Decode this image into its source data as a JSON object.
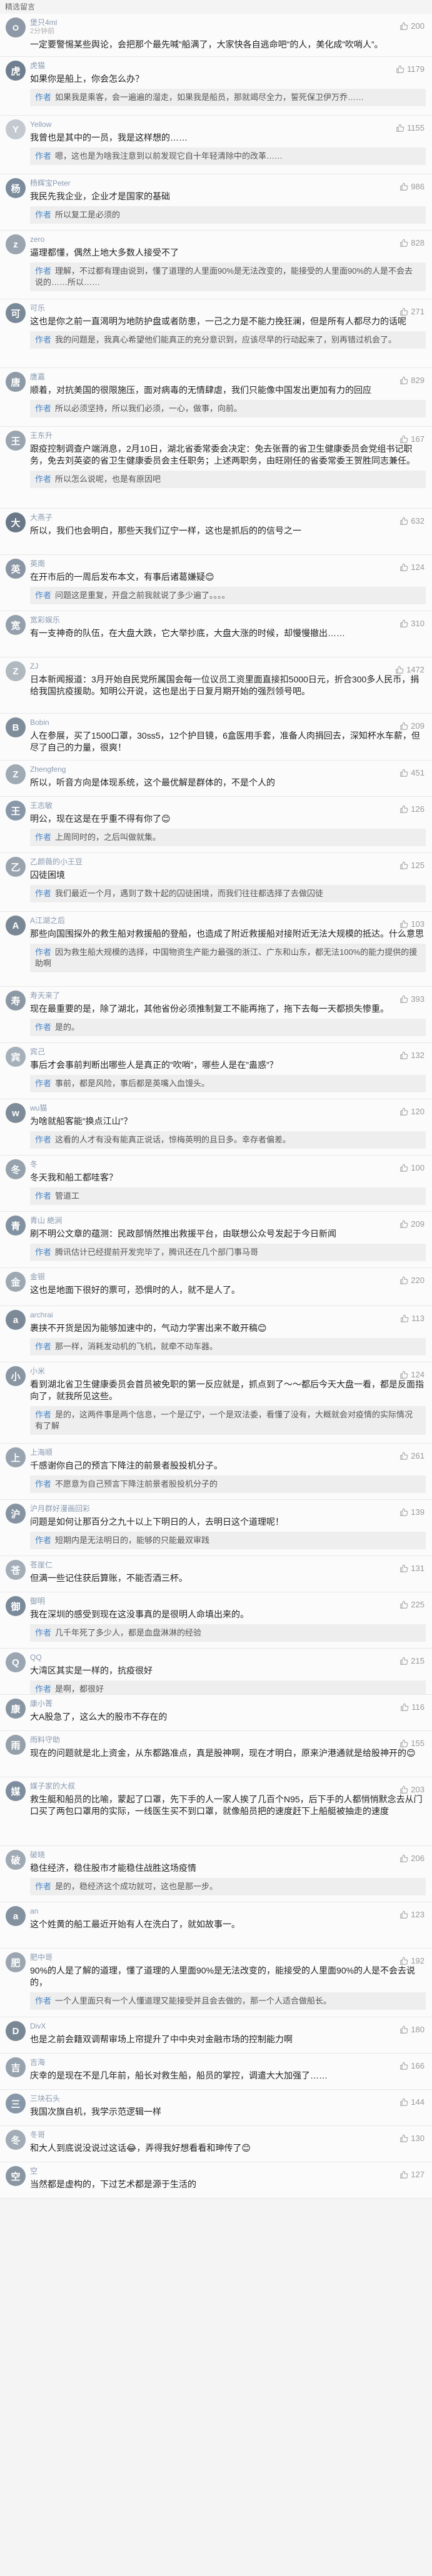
{
  "header": {
    "title": "精选留言"
  },
  "comments": [
    {
      "avatar": "ㅇ",
      "avatar_color": "#8d99a6",
      "user": "堡只4ml",
      "time": "2分钟前",
      "likes": "200",
      "text": "一定要警惕某些舆论，会把那个最先喊”船满了，大家快各自逃命吧”的人，美化成”吹哨人”。",
      "reply_author": "",
      "reply": "",
      "h": 69
    },
    {
      "avatar": "虎",
      "avatar_color": "#6f7f8f",
      "user": "虎猫",
      "time": "",
      "likes": "1179",
      "text": "如果你是船上，你会怎么办？",
      "reply_author": "作者",
      "reply": "如果我是乘客，会一遍遍的溜走，如果我是船员，那就竭尽全力，誓死保卫伊万乔……",
      "h": 94
    },
    {
      "avatar": "Y",
      "avatar_color": "#c3c9cf",
      "user": "Yellow",
      "time": "",
      "likes": "1155",
      "text": "我曾也是其中的一员，我是这样想的……",
      "reply_author": "作者",
      "reply": "嗯，这也是为啥我注意到以前发现它自十年轻清除中的改革……",
      "h": 94
    },
    {
      "avatar": "杨",
      "avatar_color": "#7c8c9c",
      "user": "杨辉宝Peter",
      "time": "",
      "likes": "986",
      "text": "我民先我企业，企业才是国家的基础",
      "reply_author": "作者",
      "reply": "所以复工是必须的",
      "h": 90
    },
    {
      "avatar": "z",
      "avatar_color": "#9aa5b0",
      "user": "zero",
      "time": "",
      "likes": "828",
      "text": "逼理都懂，偶然上地大多数人接受不了",
      "reply_author": "作者",
      "reply": "理解，不过都有理由说到，懂了道理的人里面90%是无法改变的，能接受的人里面90%的人是不会去说的……所以……",
      "h": 110
    },
    {
      "avatar": "可",
      "avatar_color": "#7a8a98",
      "user": "可乐",
      "time": "",
      "likes": "271",
      "text": "这也是你之前一直渴明为地防护盘或者防患，一己之力是不能力挽狂澜，但是所有人都尽力的话呢",
      "reply_author": "作者",
      "reply": "我的问题是，我真心希望他们能真正的充分意识到，应该尽早的行动起来了，别再错过机会了。",
      "h": 110
    },
    {
      "avatar": "唐",
      "avatar_color": "#8e9aa6",
      "user": "唐嘉",
      "time": "",
      "likes": "829",
      "text": "顺着，对抗美国的很限施压，面对病毒的无情肆虐，我们只能像中国发出更加有力的回应",
      "reply_author": "作者",
      "reply": "所以必须坚持，所以我们必须，一心，做事，向前。",
      "h": 94
    },
    {
      "avatar": "王",
      "avatar_color": "#9aa5b0",
      "user": "王东升",
      "time": "",
      "likes": "167",
      "text": "跟疫控制调查户端消息，2月10日，湖北省委常委会决定：免去张晋的省卫生健康委员会党组书记职务，免去刘英姿的省卫生健康委员会主任职务；上述两职务，由旺刚任的省委常委王贺胜同志兼任。",
      "reply_author": "作者",
      "reply": "所以怎么说呢，也是有原因吧",
      "h": 131
    },
    {
      "avatar": "大",
      "avatar_color": "#6a7888",
      "user": "大燕子",
      "time": "",
      "likes": "632",
      "text": "所以，我们也会明白，那些天我们辽宁一样，这也是抓后的的信号之一",
      "reply_author": "",
      "reply": "",
      "h": 74
    },
    {
      "avatar": "英",
      "avatar_color": "#8a96a4",
      "user": "英南",
      "time": "",
      "likes": "124",
      "text": "在开市后的一周后发布本文，有事后诸葛嫌疑😊",
      "reply_author": "作者",
      "reply": "问题这是重复，开盘之前我就说了多少遍了。。。。",
      "h": 90
    },
    {
      "avatar": "宽",
      "avatar_color": "#94a0ac",
      "user": "宽彩娱乐",
      "time": "",
      "likes": "310",
      "text": "有一支神奇的队伍，在大盘大跌，它大举抄底，大盘大涨的时候，却慢慢撤出……",
      "reply_author": "",
      "reply": "",
      "h": 74
    },
    {
      "avatar": "Z",
      "avatar_color": "#b0b8c0",
      "user": "ZJ",
      "time": "",
      "likes": "1472",
      "text": "日本新闻报道：3月开始自民党所属国会每一位议员工资里面直接扣5000日元，折合300多人民币，捐给我国抗疫援助。知明公开说，这也是出于日复月期开始的强烈领号吧。",
      "reply_author": "",
      "reply": "",
      "h": 90
    },
    {
      "avatar": "B",
      "avatar_color": "#7f8d9b",
      "user": "Bobin",
      "time": "",
      "likes": "209",
      "text": "人在参展，买了1500口罩，30ss5，12个护目镜，6盒医用手套，准备人肉捐回去，深知杯水车薪，但尽了自己的力量，很爽！",
      "reply_author": "",
      "reply": "",
      "h": 75
    },
    {
      "avatar": "Z",
      "avatar_color": "#a0aab4",
      "user": "Zhengfeng",
      "time": "",
      "likes": "451",
      "text": "所以，听音方向是体现系统，这个最优解是群体的，不是个人的",
      "reply_author": "",
      "reply": "",
      "h": 58
    },
    {
      "avatar": "王",
      "avatar_color": "#8898a8",
      "user": "王志敏",
      "time": "",
      "likes": "126",
      "text": "明公，现在这是在乎重不得有你了😊",
      "reply_author": "作者",
      "reply": "上周同时的，之后叫做就集。",
      "h": 90
    },
    {
      "avatar": "乙",
      "avatar_color": "#9aa4ae",
      "user": "乙颜薇的小王豆",
      "time": "",
      "likes": "125",
      "text": "囚徒困境",
      "reply_author": "作者",
      "reply": "我们最近一个月，遇到了数十起的囚徒困境，而我们往往都选择了去做囚徒",
      "h": 94
    },
    {
      "avatar": "A",
      "avatar_color": "#7a8896",
      "user": "A江湖之后",
      "time": "",
      "likes": "103",
      "text": "那些向国围探外的救生船对救援船的登船，也造成了附近救援船对接附近无法大规模的抵达。什么意思",
      "reply_author": "作者",
      "reply": "因为救生船大规模的选择，中国物资生产能力最强的浙江、广东和山东，都无法100%的能力提供的援助啊",
      "h": 120
    },
    {
      "avatar": "寿",
      "avatar_color": "#8c98a4",
      "user": "寿天来了",
      "time": "",
      "likes": "393",
      "text": "现在最重要的是，除了湖北，其他省份必须推制复工不能再拖了，拖下去每一天都损失惨重。",
      "reply_author": "作者",
      "reply": "是的。",
      "h": 90
    },
    {
      "avatar": "宾",
      "avatar_color": "#a6b0ba",
      "user": "宾己",
      "time": "",
      "likes": "132",
      "text": "事后才会事前判断出哪些人是真正的”吹哨”，哪些人是在”蛊惑”？",
      "reply_author": "作者",
      "reply": "事前，都是风险，事后都是英嘴入血馒头。",
      "h": 90
    },
    {
      "avatar": "w",
      "avatar_color": "#7e8c9a",
      "user": "wu猫",
      "time": "",
      "likes": "120",
      "text": "为啥就船客能”换点江山”？",
      "reply_author": "作者",
      "reply": "这看的人才有没有能真正说话，惊梅英明的且日多。幸存者偏差。",
      "h": 90
    },
    {
      "avatar": "冬",
      "avatar_color": "#96a2ae",
      "user": "冬",
      "time": "",
      "likes": "100",
      "text": "冬天我和船工都哇客？",
      "reply_author": "作者",
      "reply": "管道工",
      "h": 90
    },
    {
      "avatar": "青",
      "avatar_color": "#8292a2",
      "user": "青山 絶涧",
      "time": "",
      "likes": "209",
      "text": "刷不明公文章的蕴测：民政部悄然推出救援平台，由联想公众号发起于今日新闻",
      "reply_author": "作者",
      "reply": "腾讯估计已经提前开发完毕了，腾讯还在几个部门事马哥",
      "h": 90
    },
    {
      "avatar": "金",
      "avatar_color": "#9ea8b2",
      "user": "金银",
      "time": "",
      "likes": "220",
      "text": "这也是地面下很好的票可，恐惧时的人，就不是人了。",
      "reply_author": "",
      "reply": "",
      "h": 61
    },
    {
      "avatar": "a",
      "avatar_color": "#7c8a98",
      "user": "archrai",
      "time": "",
      "likes": "113",
      "text": "裹挟不开货是因为能够加速中的，气动力学害出来不敢开稿😊",
      "reply_author": "作者",
      "reply": "那一样，消耗发动机的飞机，就牵不动车器。",
      "h": 90
    },
    {
      "avatar": "小",
      "avatar_color": "#8a96a2",
      "user": "小米",
      "time": "",
      "likes": "124",
      "text": "看到湖北省卫生健康委员会首员被免职的第一反应就是，抓点到了～～都后今天大盘一看，都是反面指向了，就我所见这些。",
      "reply_author": "作者",
      "reply": "是的，这两件事是两个信息，一个是辽宁，一个是双法委，看懂了没有，大概就会对疫情的实际情况有了解",
      "h": 130
    },
    {
      "avatar": "上",
      "avatar_color": "#98a4b0",
      "user": "上海顺",
      "time": "",
      "likes": "261",
      "text": "千感谢你自己的预言下降注的前景者股投机分子。",
      "reply_author": "作者",
      "reply": "不愿意为自己预言下降注前景者股投机分子的",
      "h": 90
    },
    {
      "avatar": "沪",
      "avatar_color": "#8694a2",
      "user": "沪月群好漫画回彩",
      "time": "",
      "likes": "139",
      "text": "问题是如何让那百分之九十以上下明日的人，去明日这个道理呢！",
      "reply_author": "作者",
      "reply": "短期内是无法明日的，能够的只能最双审践",
      "h": 90
    },
    {
      "avatar": "苍",
      "avatar_color": "#a4aeb8",
      "user": "苍崖仁",
      "time": "",
      "likes": "131",
      "text": "但满一些记住获后算账，不能否酒三杯。",
      "reply_author": "",
      "reply": "",
      "h": 58
    },
    {
      "avatar": "御",
      "avatar_color": "#7a8a9a",
      "user": "御明",
      "time": "",
      "likes": "225",
      "text": "我在深圳的感受到现在这没事真的是很明人命填出来的。",
      "reply_author": "作者",
      "reply": "几千年死了多少人，都是血盘淋淋的经验",
      "h": 90
    },
    {
      "avatar": "Q",
      "avatar_color": "#9aa6b2",
      "user": "QQ",
      "time": "",
      "likes": "215",
      "text": "大湾区其实是一样的，抗疫很好",
      "reply_author": "作者",
      "reply": "是啊，都很好",
      "h": 74
    },
    {
      "avatar": "康",
      "avatar_color": "#8896a4",
      "user": "康小菁",
      "time": "",
      "likes": "116",
      "text": "大A股急了，这么大的股市不存在的",
      "reply_author": "",
      "reply": "",
      "h": 58
    },
    {
      "avatar": "雨",
      "avatar_color": "#96a0aa",
      "user": "雨料守助",
      "time": "",
      "likes": "155",
      "text": "现在的问题就是北上资金，从东都路准点，真是股神啊，现在才明白，原来沪港通就是给股神开的😊",
      "reply_author": "",
      "reply": "",
      "h": 74
    },
    {
      "avatar": "媒",
      "avatar_color": "#7e8e9e",
      "user": "媒子家的大叔",
      "time": "",
      "likes": "203",
      "text": "救生艇和船员的比喻，蒙起了口罩，先下手的人一家人挨了几百个N95，后下手的人都悄悄默念去从门口买了两包口罩用的实际，一线医生买不到口罩，就像船员把的速度赶下上船艇被抽走的速度",
      "reply_author": "",
      "reply": "",
      "h": 110
    },
    {
      "avatar": "破",
      "avatar_color": "#a0aab4",
      "user": "破晓",
      "time": "",
      "likes": "206",
      "text": "稳住经济，稳住股市才能稳住战胜这场疫情",
      "reply_author": "作者",
      "reply": "是的，稳经济这个成功就可，这也是那一步。",
      "h": 90
    },
    {
      "avatar": "a",
      "avatar_color": "#8492a0",
      "user": "an",
      "time": "",
      "likes": "123",
      "text": "这个姓黄的船工最近开始有人在洗白了，就如故事一。",
      "reply_author": "",
      "reply": "",
      "h": 74
    },
    {
      "avatar": "肥",
      "avatar_color": "#9ca6b0",
      "user": "肥中哥",
      "time": "",
      "likes": "192",
      "text": "90%的人是了解的道理，懂了道理的人里面90%是无法改变的，能接受的人里面90%的人是不会去说的，",
      "reply_author": "作者",
      "reply": "一个人里面只有一个人懂道理又能接受并且会去做的，那一个人适合做船长。",
      "h": 110
    },
    {
      "avatar": "D",
      "avatar_color": "#7a8896",
      "user": "DivX",
      "time": "",
      "likes": "180",
      "text": "也是之前会籍双调帮审场上帘提升了中中央对金融市场的控制能力啊",
      "reply_author": "",
      "reply": "",
      "h": 58
    },
    {
      "avatar": "吉",
      "avatar_color": "#96a2ae",
      "user": "吉海",
      "time": "",
      "likes": "166",
      "text": "庆幸的是现在不是几年前，船长对救生船，船员的掌控，调遣大大加强了……",
      "reply_author": "",
      "reply": "",
      "h": 58
    },
    {
      "avatar": "三",
      "avatar_color": "#8898a8",
      "user": "三块石头",
      "time": "",
      "likes": "144",
      "text": "我国次旗自机，我学示范逻辑一样",
      "reply_author": "",
      "reply": "",
      "h": 58
    },
    {
      "avatar": "冬",
      "avatar_color": "#a2acb6",
      "user": "冬哥",
      "time": "",
      "likes": "130",
      "text": "和大人到底说没说过这话😂，弄得我好想看看和珅传了😊",
      "reply_author": "",
      "reply": "",
      "h": 58
    },
    {
      "avatar": "空",
      "avatar_color": "#8a96a2",
      "user": "空",
      "time": "",
      "likes": "127",
      "text": "当然都是虚构的，下过艺术都是源于生活的",
      "reply_author": "",
      "reply": "",
      "h": 58
    }
  ]
}
